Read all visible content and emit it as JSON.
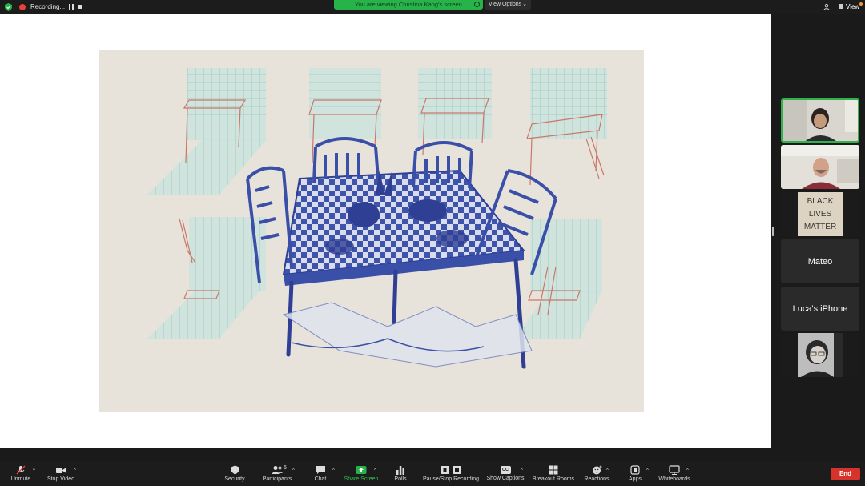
{
  "topbar": {
    "recording_label": "Recording...",
    "viewing_banner": "You are viewing Christina Kang's screen",
    "view_options_label": "View Options",
    "view_label": "View"
  },
  "share": {
    "artwork_description": "Illustrated artwork: blue ink table with four chairs laden with food, surrounded by faint red and teal drawings of tables, chairs and ladders on tiled grids"
  },
  "gallery": {
    "tiles": [
      {
        "name": "",
        "type": "video",
        "active": true
      },
      {
        "name": "",
        "type": "video"
      },
      {
        "name": "",
        "type": "image"
      },
      {
        "name": "Mateo",
        "type": "name"
      },
      {
        "name": "Luca's iPhone",
        "type": "name"
      },
      {
        "name": "",
        "type": "video"
      }
    ]
  },
  "toolbar": {
    "unmute": "Unmute",
    "stop_video": "Stop Video",
    "security": "Security",
    "participants": "Participants",
    "participants_count": "6",
    "chat": "Chat",
    "share_screen": "Share Screen",
    "polls": "Polls",
    "pause_stop_recording": "Pause/Stop Recording",
    "show_captions": "Show Captions",
    "captions_badge": "CC",
    "breakout_rooms": "Breakout Rooms",
    "reactions": "Reactions",
    "apps": "Apps",
    "whiteboards": "Whiteboards",
    "end": "End"
  },
  "colors": {
    "share_green": "#27b34a",
    "end_red": "#d8332b",
    "recording_red": "#e8403a",
    "ink_blue": "#3a4fa8",
    "sketch_red": "#c9776a",
    "grid_teal": "#9fd1cf"
  }
}
